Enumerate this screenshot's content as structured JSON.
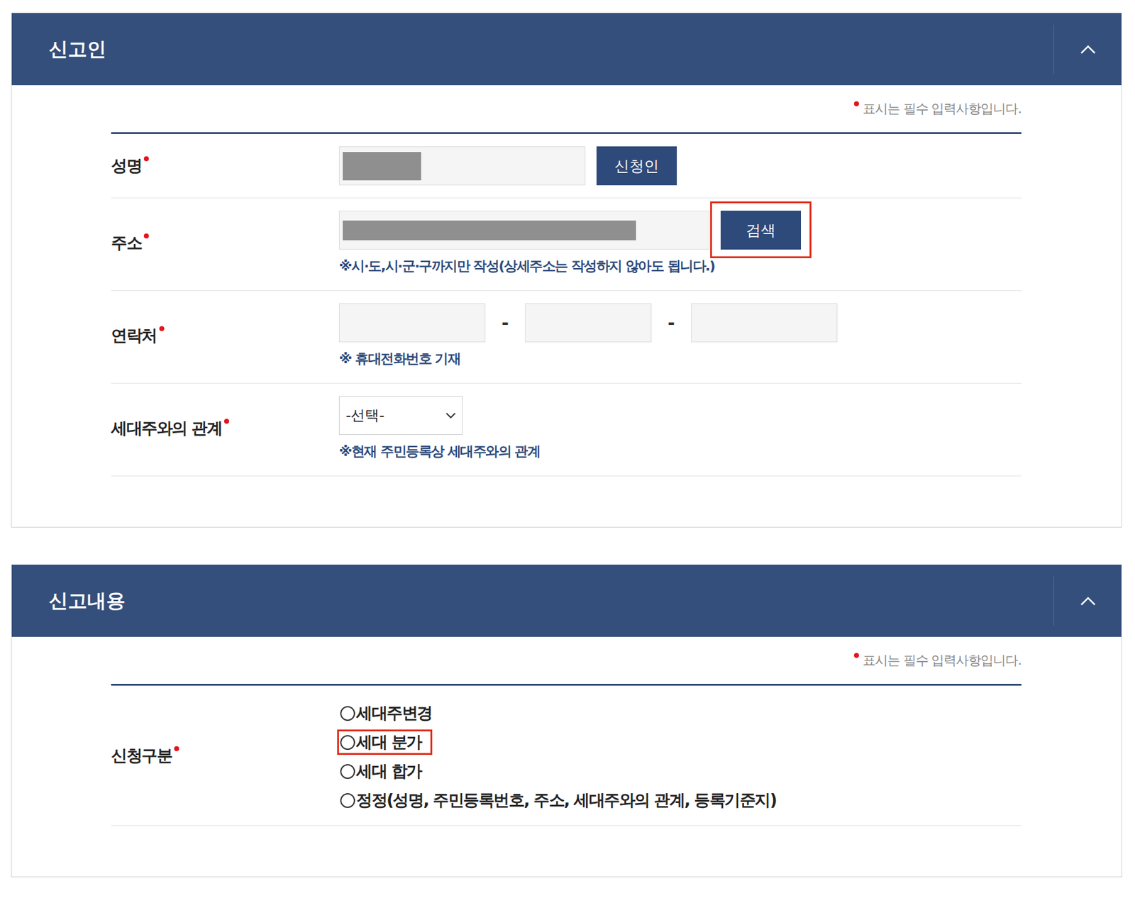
{
  "reporter": {
    "title": "신고인",
    "expanded": true,
    "required_note": "표시는 필수 입력사항입니다.",
    "fields": [
      {
        "kind": "name",
        "label": "성명",
        "required": true,
        "redacted": true,
        "button": {
          "label": "신청인",
          "highlighted": false
        }
      },
      {
        "kind": "address",
        "label": "주소",
        "required": true,
        "redacted": true,
        "button": {
          "label": "검색",
          "highlighted": true
        },
        "note": "※시·도,시·군·구까지만 작성(상세주소는 작성하지 않아도 됩니다.)"
      },
      {
        "kind": "phone",
        "label": "연락처",
        "required": true,
        "parts": [
          "",
          "",
          ""
        ],
        "separator": "-",
        "note": "※ 휴대전화번호 기재"
      },
      {
        "kind": "select",
        "label": "세대주와의 관계",
        "required": true,
        "value": "-선택-",
        "note": "※현재 주민등록상 세대주와의 관계"
      }
    ]
  },
  "report": {
    "title": "신고내용",
    "expanded": true,
    "required_note": "표시는 필수 입력사항입니다.",
    "fields": [
      {
        "kind": "radio",
        "label": "신청구분",
        "required": true,
        "options": [
          {
            "label": "세대주변경",
            "selected": false,
            "highlighted": false
          },
          {
            "label": "세대 분가",
            "selected": false,
            "highlighted": true
          },
          {
            "label": "세대 합가",
            "selected": false,
            "highlighted": false
          },
          {
            "label": "정정(성명, 주민등록번호, 주소, 세대주와의 관계, 등록기준지)",
            "selected": false,
            "highlighted": false
          }
        ]
      }
    ]
  }
}
